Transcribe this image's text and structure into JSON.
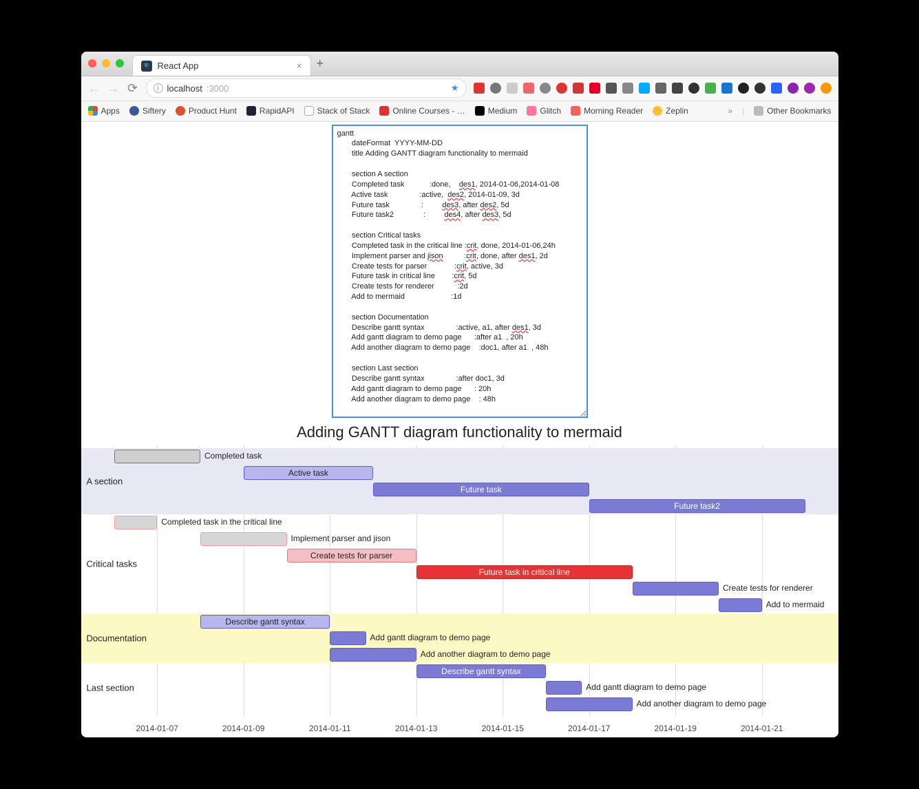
{
  "browser": {
    "tab_title": "React App",
    "url_host": "localhost",
    "url_port": ":3000",
    "bookmarks": [
      "Apps",
      "Siftery",
      "Product Hunt",
      "RapidAPI",
      "Stack of Stack",
      "Online Courses - …",
      "Medium",
      "Glitch",
      "Morning Reader",
      "Zeplin"
    ],
    "other_bookmarks": "Other Bookmarks"
  },
  "code_lines": [
    "gantt",
    "       dateFormat  YYYY-MM-DD",
    "       title Adding GANTT diagram functionality to mermaid",
    "",
    "       section A section",
    "       Completed task            :done,    des1, 2014-01-06,2014-01-08",
    "       Active task               :active,  des2, 2014-01-09, 3d",
    "       Future task               :         des3, after des2, 5d",
    "       Future task2              :         des4, after des3, 5d",
    "",
    "       section Critical tasks",
    "       Completed task in the critical line :crit, done, 2014-01-06,24h",
    "       Implement parser and jison          :crit, done, after des1, 2d",
    "       Create tests for parser             :crit, active, 3d",
    "       Future task in critical line        :crit, 5d",
    "       Create tests for renderer           :2d",
    "       Add to mermaid                      :1d",
    "",
    "       section Documentation",
    "       Describe gantt syntax               :active, a1, after des1, 3d",
    "       Add gantt diagram to demo page      :after a1  , 20h",
    "       Add another diagram to demo page    :doc1, after a1  , 48h",
    "",
    "       section Last section",
    "       Describe gantt syntax               :after doc1, 3d",
    "       Add gantt diagram to demo page      : 20h",
    "       Add another diagram to demo page    : 48h"
  ],
  "chart_data": {
    "type": "gantt",
    "title": "Adding GANTT diagram functionality to mermaid",
    "date_format": "YYYY-MM-DD",
    "x_ticks": [
      "2014-01-07",
      "2014-01-09",
      "2014-01-11",
      "2014-01-13",
      "2014-01-15",
      "2014-01-17",
      "2014-01-19",
      "2014-01-21"
    ],
    "x_range": [
      "2014-01-06",
      "2014-01-22"
    ],
    "sections": [
      {
        "name": "A section",
        "tasks": [
          {
            "label": "Completed task",
            "start": "2014-01-06",
            "end": "2014-01-08",
            "status": "done"
          },
          {
            "label": "Active task",
            "start": "2014-01-09",
            "end": "2014-01-12",
            "status": "active"
          },
          {
            "label": "Future task",
            "start": "2014-01-12",
            "end": "2014-01-17",
            "status": "future"
          },
          {
            "label": "Future task2",
            "start": "2014-01-17",
            "end": "2014-01-22",
            "status": "future"
          }
        ]
      },
      {
        "name": "Critical tasks",
        "tasks": [
          {
            "label": "Completed task in the critical line",
            "start": "2014-01-06",
            "end": "2014-01-07",
            "status": "crit-done"
          },
          {
            "label": "Implement parser and jison",
            "start": "2014-01-08",
            "end": "2014-01-10",
            "status": "crit-done"
          },
          {
            "label": "Create tests for parser",
            "start": "2014-01-10",
            "end": "2014-01-13",
            "status": "crit-active"
          },
          {
            "label": "Future task in critical line",
            "start": "2014-01-13",
            "end": "2014-01-18",
            "status": "crit"
          },
          {
            "label": "Create tests for renderer",
            "start": "2014-01-18",
            "end": "2014-01-20",
            "status": "future"
          },
          {
            "label": "Add to mermaid",
            "start": "2014-01-20",
            "end": "2014-01-21",
            "status": "future"
          }
        ]
      },
      {
        "name": "Documentation",
        "tasks": [
          {
            "label": "Describe gantt syntax",
            "start": "2014-01-08",
            "end": "2014-01-11",
            "status": "active"
          },
          {
            "label": "Add gantt diagram to demo page",
            "start": "2014-01-11",
            "end": "2014-01-11T20",
            "status": "future"
          },
          {
            "label": "Add another diagram to demo page",
            "start": "2014-01-11",
            "end": "2014-01-13",
            "status": "future"
          }
        ]
      },
      {
        "name": "Last section",
        "tasks": [
          {
            "label": "Describe gantt syntax",
            "start": "2014-01-13",
            "end": "2014-01-16",
            "status": "future"
          },
          {
            "label": "Add gantt diagram to demo page",
            "start": "2014-01-16",
            "end": "2014-01-16T20",
            "status": "future"
          },
          {
            "label": "Add another diagram to demo page",
            "start": "2014-01-16",
            "end": "2014-01-18",
            "status": "future"
          }
        ]
      }
    ]
  }
}
